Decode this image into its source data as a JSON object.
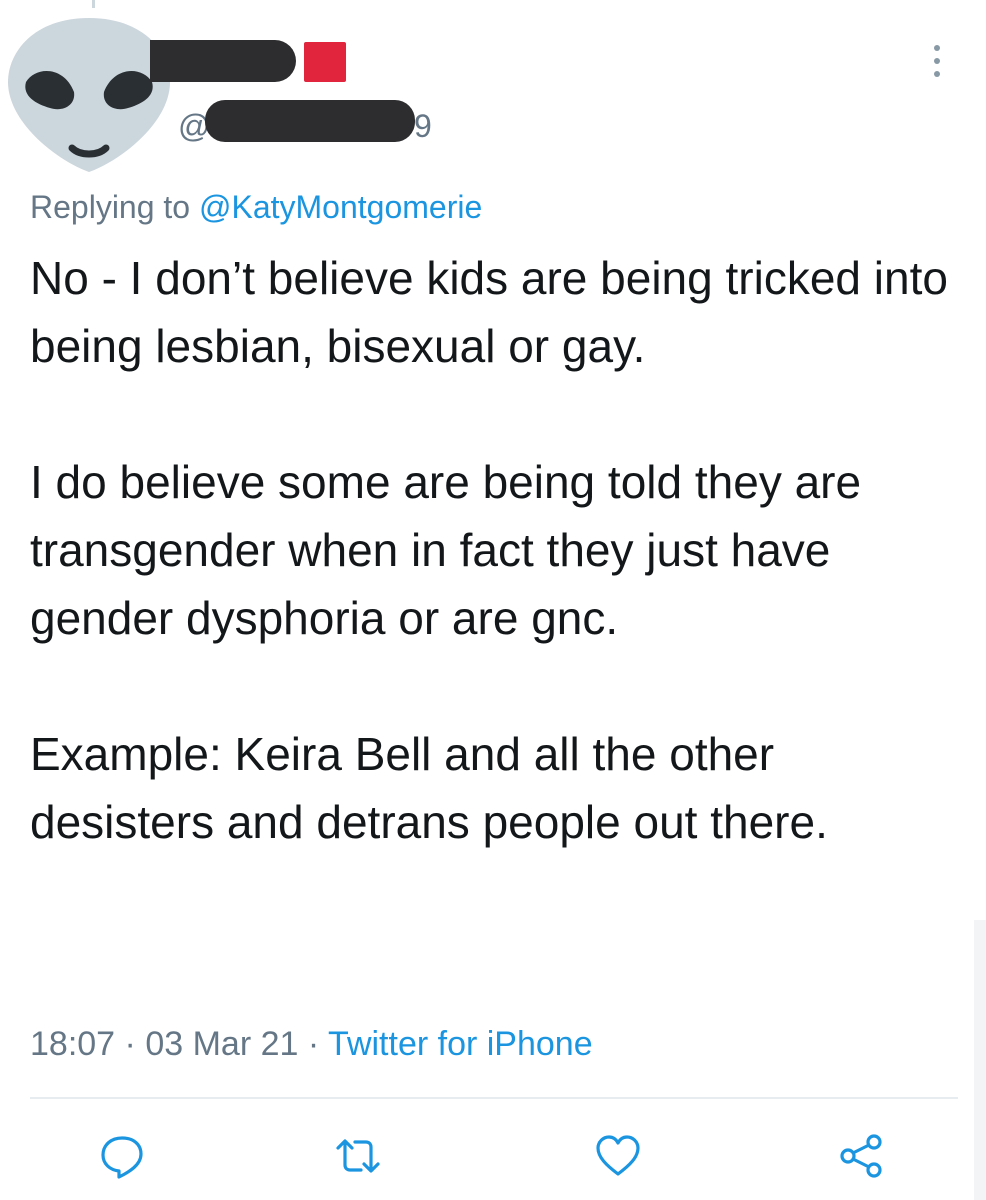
{
  "tweet": {
    "handle_prefix": "@",
    "handle_suffix": "9",
    "replying_prefix": "Replying to",
    "replying_to": "@KatyMontgomerie",
    "paragraphs": [
      "No - I don’t believe kids are being tricked into being lesbian, bisexual or gay.",
      "I do believe some are being told they are transgender when in fact they just have gender dysphoria or are gnc.",
      "Example: Keira Bell and all the other desisters and detrans people out there."
    ],
    "time": "18:07",
    "date": "03 Mar 21",
    "separator": "·",
    "source": "Twitter for iPhone"
  },
  "icons": {
    "avatar": "alien-face-icon",
    "more": "more-vertical-icon",
    "reply": "reply-icon",
    "retweet": "retweet-icon",
    "like": "like-icon",
    "share": "share-icon"
  },
  "colors": {
    "text": "#14171a",
    "secondary": "#657786",
    "link": "#1b95e0",
    "icon": "#1b95e0",
    "badge": "#e0253c",
    "avatar_bg": "#ccd6dd",
    "redaction": "#2d2d2f"
  }
}
